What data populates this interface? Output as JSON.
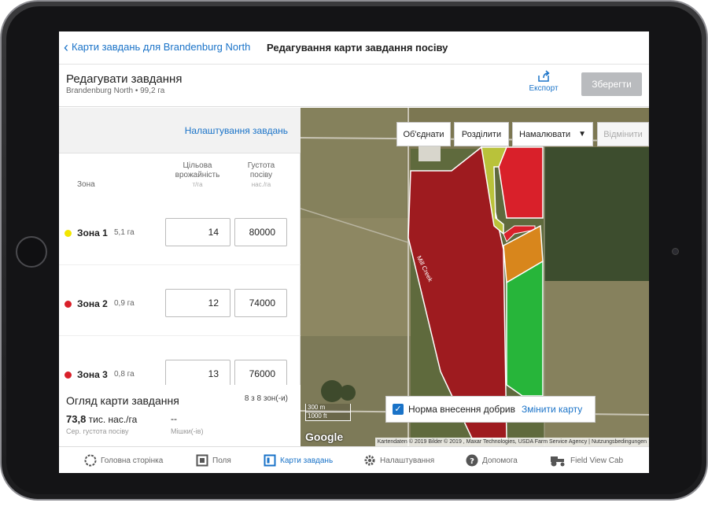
{
  "topbar": {
    "back_label": "Карти завдань для Brandenburg North",
    "title": "Редагування карти завдання посіву"
  },
  "editbar": {
    "title": "Редагувати завдання",
    "subtitle": "Brandenburg North • 99,2 га",
    "export_label": "Експорт",
    "save_label": "Зберегти"
  },
  "left": {
    "settings_link": "Налаштування завдань",
    "col_zone": "Зона",
    "col_yield": "Цільова врожайність",
    "col_yield_unit": "т/га",
    "col_density": "Густота посіву",
    "col_density_unit": "нас./га",
    "zones": [
      {
        "name": "Зона 1",
        "area": "5,1 га",
        "yield": "14",
        "density": "80000",
        "color": "#f2e600"
      },
      {
        "name": "Зона 2",
        "area": "0,9 га",
        "yield": "12",
        "density": "74000",
        "color": "#d9202a"
      },
      {
        "name": "Зона 3",
        "area": "0,8 га",
        "yield": "13",
        "density": "76000",
        "color": "#d9202a"
      }
    ],
    "overview": {
      "title": "Огляд карти завдання",
      "count": "8 з 8 зон(-и)",
      "avg_value": "73,8",
      "avg_unit": "тис. нас./га",
      "avg_label": "Сер. густота посіву",
      "bags_value": "--",
      "bags_label": "Мішки(-ів)"
    }
  },
  "map": {
    "tools": {
      "merge": "Об'єднати",
      "split": "Розділити",
      "draw": "Намалювати",
      "undo": "Відмінити"
    },
    "legend_label": "Норма внесення добрив",
    "change_map": "Змінити карту",
    "scale_m": "300 m",
    "scale_ft": "1000 ft",
    "google": "Google",
    "attribution": "Kartendaten © 2019 Bilder © 2019 , Maxar Technologies, USDA Farm Service Agency | Nutzungsbedingungen",
    "road_label": "Mill Creek"
  },
  "nav": {
    "home": "Головна сторінка",
    "fields": "Поля",
    "prescriptions": "Карти завдань",
    "settings": "Налаштування",
    "help": "Допомога",
    "cab": "Field View Cab"
  },
  "colors": {
    "accent": "#1a73c8",
    "zone_yellow": "#f2e600",
    "zone_red": "#d9202a",
    "zone_dark_red": "#9e1b1f",
    "zone_orange": "#d8861c",
    "zone_green": "#27b53a",
    "zone_lime": "#b9c23a"
  }
}
